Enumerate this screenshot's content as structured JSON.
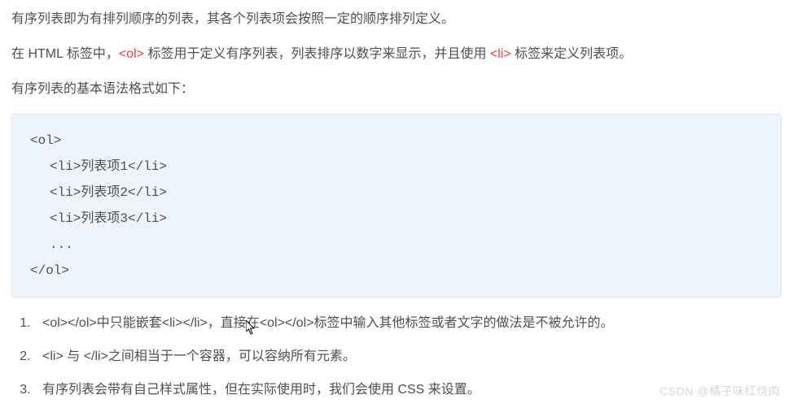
{
  "para1": {
    "text": "有序列表即为有排列顺序的列表，其各个列表项会按照一定的顺序排列定义。"
  },
  "para2": {
    "before1": "在 HTML 标签中，",
    "tag1": "<ol>",
    "middle1": " 标签用于定义有序列表，列表排序以数字来显示，并且使用 ",
    "tag2": "<li>",
    "after1": " 标签来定义列表项。"
  },
  "para3": {
    "text": "有序列表的基本语法格式如下："
  },
  "code": {
    "l1": "<ol>",
    "l2": "<li>列表项1</li>",
    "l3": "<li>列表项2</li>",
    "l4": "<li>列表项3</li>",
    "l5": "...",
    "l6": "</ol>"
  },
  "notes": {
    "n1": "<ol></ol>中只能嵌套<li></li>，直接在<ol></ol>标签中输入其他标签或者文字的做法是不被允许的。",
    "n2": "<li> 与 </li>之间相当于一个容器，可以容纳所有元素。",
    "n3": "有序列表会带有自己样式属性，但在实际使用时，我们会使用 CSS 来设置。"
  },
  "watermark": "CSDN @橘子味红烧肉"
}
